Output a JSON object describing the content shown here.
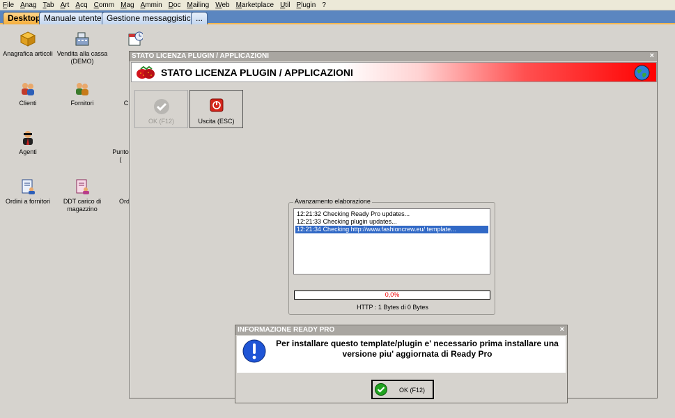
{
  "menu": [
    "File",
    "Anag",
    "Tab",
    "Art",
    "Acq",
    "Comm",
    "Mag",
    "Ammin",
    "Doc",
    "Mailing",
    "Web",
    "Marketplace",
    "Util",
    "Plugin",
    "?"
  ],
  "tabs": [
    "Desktop",
    "Manuale utente",
    "Gestione messaggistica",
    "..."
  ],
  "desktop": {
    "icons": [
      {
        "label": "Anagrafica articoli",
        "icon": "box-icon"
      },
      {
        "label": "Vendita alla cassa\n(DEMO)",
        "icon": "cash-register-icon"
      },
      {
        "label": "A",
        "icon": "calendar-clock-icon"
      },
      {
        "label": "Clienti",
        "icon": "clients-icon"
      },
      {
        "label": "Fornitori",
        "icon": "suppliers-icon"
      },
      {
        "label": "C",
        "icon": "partial-icon"
      },
      {
        "label": "Agenti",
        "icon": "agent-icon"
      },
      {
        "label": "Punto\n(",
        "icon": "partial-icon"
      },
      {
        "label": "Ordini a fornitori",
        "icon": "order-doc-icon"
      },
      {
        "label": "DDT carico di\nmagazzino",
        "icon": "ddt-doc-icon"
      },
      {
        "label": "Ord",
        "icon": "partial-icon"
      }
    ]
  },
  "window": {
    "title": "STATO LICENZA PLUGIN / APPLICAZIONI",
    "header_title": "STATO LICENZA PLUGIN / APPLICAZIONI",
    "close": "×",
    "buttons": {
      "ok": "OK (F12)",
      "exit": "Uscita (ESC)"
    },
    "progress_group": {
      "legend": "Avanzamento elaborazione",
      "log": [
        {
          "time": "12:21:32",
          "text": "Checking Ready Pro updates..."
        },
        {
          "time": "12:21:33",
          "text": "Checking plugin updates..."
        },
        {
          "time": "12:21:34",
          "text": "Checking http://www.fashioncrew.eu/ template..."
        }
      ],
      "progress_text": "0,0%",
      "progress_fraction": 0.0,
      "http_status": "HTTP : 1 Bytes di 0 Bytes"
    }
  },
  "dialog": {
    "title": "INFORMAZIONE READY PRO",
    "close": "×",
    "message": "Per installare questo template/plugin e' necessario prima installare una versione piu' aggiornata di Ready Pro",
    "ok_label": "OK (F12)"
  },
  "colors": {
    "tabbar": "#5b86c0",
    "active_tab": "#f5ae3c",
    "header_red": "#ff0000",
    "selection": "#3169c6",
    "progress_text": "#e00000",
    "ok_green": "#1fa21f",
    "info_blue": "#1f55d6"
  }
}
